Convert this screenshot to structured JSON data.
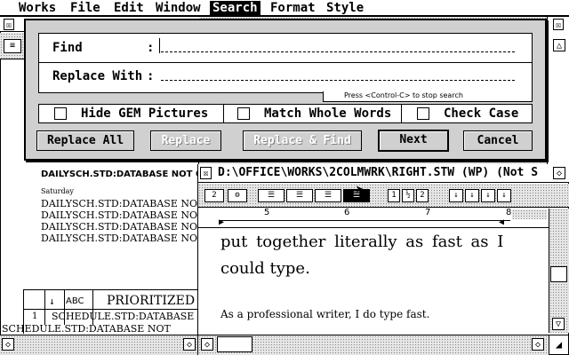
{
  "menubar": {
    "items": [
      "Works",
      "File",
      "Edit",
      "Window",
      "Search",
      "Format",
      "Style"
    ],
    "active": "Search"
  },
  "dialog": {
    "find_label": "Find",
    "find_colon": ":",
    "find_value": "",
    "replace_label": "Replace With",
    "replace_colon": ":",
    "replace_value": "",
    "hint": "Press <Control-C> to stop search",
    "options": {
      "hide_gem": {
        "label": "Hide GEM Pictures",
        "checked": false
      },
      "match_whole": {
        "label": "Match Whole Words",
        "checked": false
      },
      "check_case": {
        "label": "Check Case",
        "checked": false
      }
    },
    "buttons": {
      "replace_all": "Replace All",
      "replace": "Replace",
      "replace_find": "Replace & Find",
      "next": "Next",
      "cancel": "Cancel"
    }
  },
  "left_window": {
    "title_line": "DAILYSCH.STD:DATABASE NOT ON D",
    "day": "Saturday",
    "rows": [
      "DAILYSCH.STD:DATABASE NOT",
      "DAILYSCH.STD:DATABASE NOT",
      "DAILYSCH.STD:DATABASE NOT",
      "DAILYSCH.STD:DATABASE NOT"
    ],
    "table": {
      "sort_glyph": "↓",
      "abc": "ABC",
      "header": "PRIORITIZED",
      "row_num": "1",
      "row_cell": "SCHEDULE.STD:DATABASE",
      "row_cell2": "SCHEDULE.STD:DATABASE NOT"
    }
  },
  "doc_window": {
    "title": "D:\\OFFICE\\WORKS\\2COLMWRK\\RIGHT.STW (WP) (Not S",
    "toolbar": {
      "num_btn": "2",
      "col_buttons": [
        "1",
        "½",
        "2"
      ]
    },
    "ruler_marks": [
      "5",
      "6",
      "7",
      "8"
    ],
    "text_line1": "put together literally as fast as I",
    "text_line2": "could type.",
    "text_line3": "As a professional writer, I do type fast."
  }
}
